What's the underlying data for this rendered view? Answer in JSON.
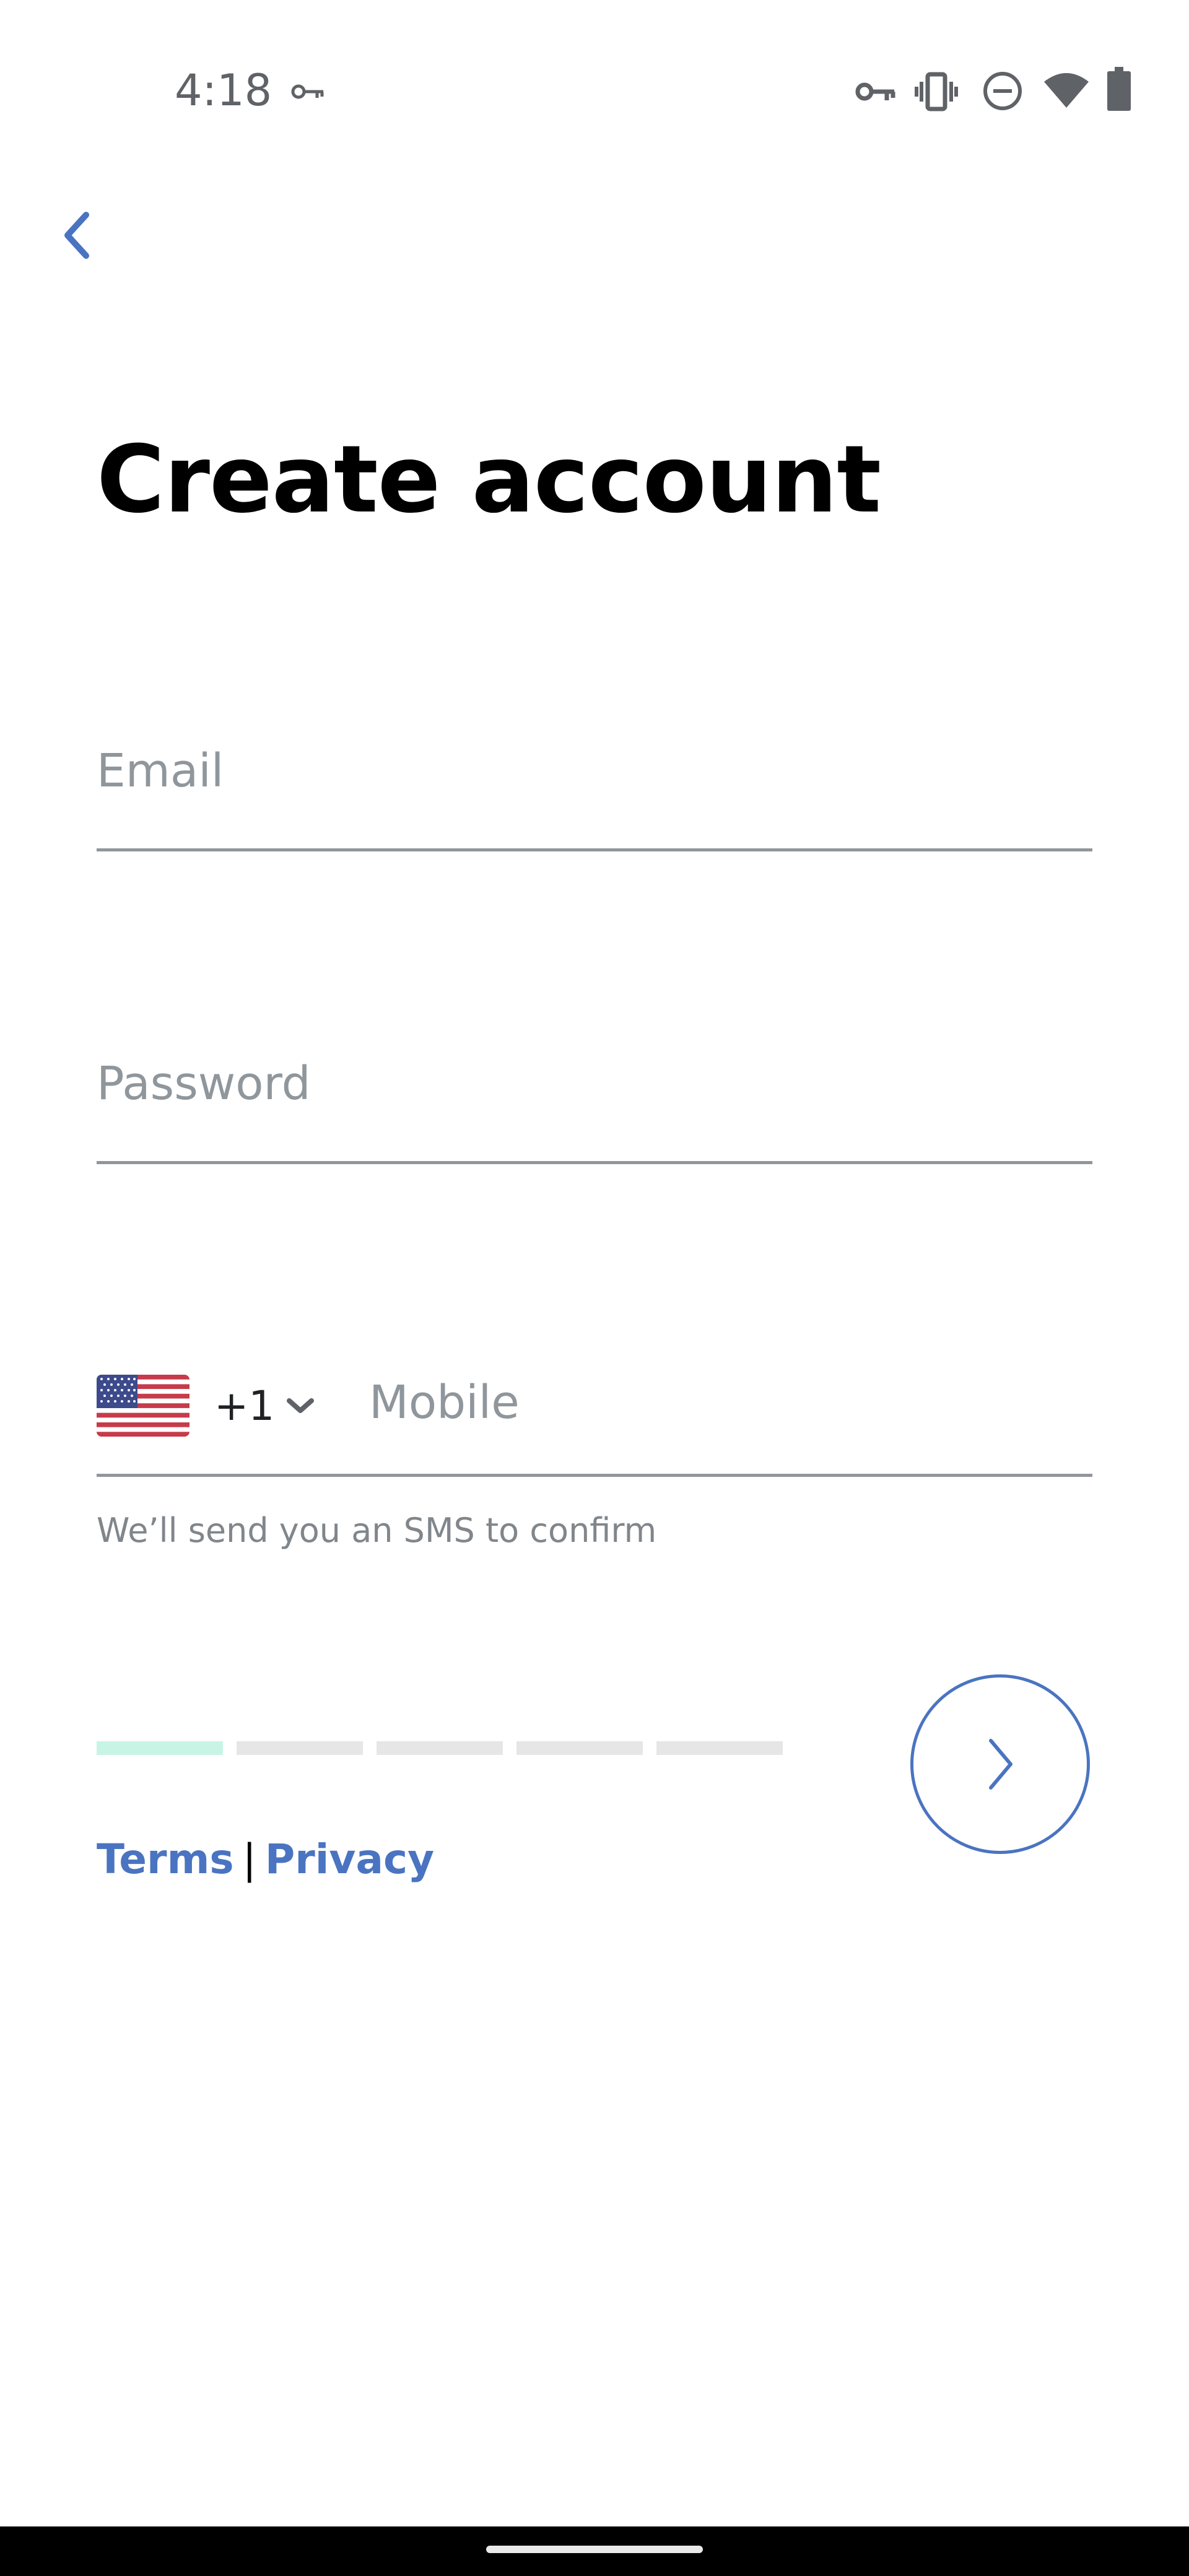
{
  "status_bar": {
    "time": "4:18",
    "icons": [
      "vpn-key-icon",
      "vpn-key-icon",
      "vibrate-icon",
      "do-not-disturb-icon",
      "wifi-icon",
      "battery-icon"
    ]
  },
  "page": {
    "title": "Create account"
  },
  "form": {
    "email_placeholder": "Email",
    "password_placeholder": "Password",
    "country_dial_code": "+1",
    "country_flag": "us-flag-icon",
    "mobile_placeholder": "Mobile",
    "helper_text": "We’ll send you an SMS to confirm"
  },
  "progress": {
    "total_steps": 5,
    "current_step": 1
  },
  "links": {
    "terms": "Terms",
    "separator": "|",
    "privacy": "Privacy"
  },
  "colors": {
    "accent": "#4a74c1",
    "progress_active": "#c8f4e6",
    "progress_inactive": "#e6e6e6",
    "placeholder": "#8f969c"
  }
}
